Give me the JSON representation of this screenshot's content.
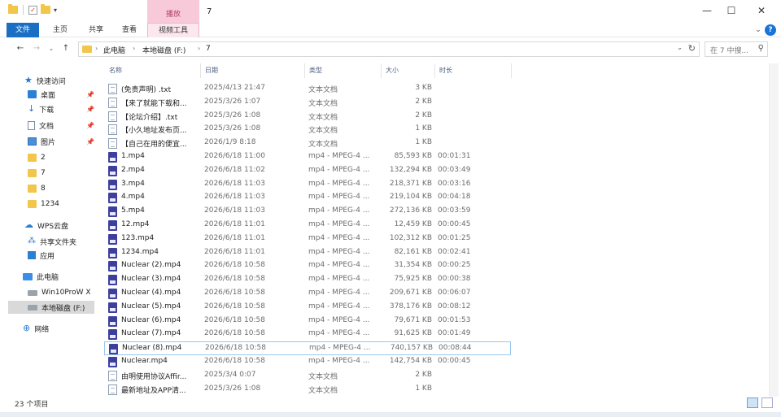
{
  "window": {
    "title": "7",
    "context_tab_top": "播放",
    "controls": {
      "minimize": "—",
      "maximize": "☐",
      "close": "✕"
    }
  },
  "ribbon": {
    "tabs": [
      "文件",
      "主页",
      "共享",
      "查看",
      "视频工具"
    ],
    "help": "?"
  },
  "address": {
    "crumbs": [
      "此电脑",
      "本地磁盘 (F:)",
      "7"
    ],
    "search_placeholder": "在 7 中搜..."
  },
  "sidebar": {
    "items": [
      {
        "label": "快速访问",
        "icon": "star-icon"
      },
      {
        "label": "桌面",
        "icon": "desktop-icon",
        "pinned": true
      },
      {
        "label": "下载",
        "icon": "download-icon",
        "pinned": true
      },
      {
        "label": "文档",
        "icon": "document-icon",
        "pinned": true
      },
      {
        "label": "图片",
        "icon": "pictures-icon",
        "pinned": true
      },
      {
        "label": "2",
        "icon": "folder-icon"
      },
      {
        "label": "7",
        "icon": "folder-icon"
      },
      {
        "label": "8",
        "icon": "folder-icon"
      },
      {
        "label": "1234",
        "icon": "folder-icon"
      },
      {
        "label": "WPS云盘",
        "icon": "cloud-icon"
      },
      {
        "label": "共享文件夹",
        "icon": "share-icon"
      },
      {
        "label": "应用",
        "icon": "apps-icon"
      },
      {
        "label": "此电脑",
        "icon": "pc-icon"
      },
      {
        "label": "Win10ProW X",
        "icon": "drive-icon"
      },
      {
        "label": "本地磁盘 (F:)",
        "icon": "drive-icon",
        "selected": true
      },
      {
        "label": "网络",
        "icon": "network-icon"
      }
    ]
  },
  "columns": {
    "name": "名称",
    "date": "日期",
    "type": "类型",
    "size": "大小",
    "duration": "时长"
  },
  "files": [
    {
      "name": "(免责声明) .txt",
      "date": "2025/4/13 21:47",
      "type": "文本文档",
      "size": "3 KB",
      "duration": "",
      "kind": "txt"
    },
    {
      "name": "【来了就能下载和...",
      "date": "2025/3/26 1:07",
      "type": "文本文档",
      "size": "2 KB",
      "duration": "",
      "kind": "txt"
    },
    {
      "name": "【论坛介绍】.txt",
      "date": "2025/3/26 1:08",
      "type": "文本文档",
      "size": "2 KB",
      "duration": "",
      "kind": "txt"
    },
    {
      "name": "【小久地址发布页...",
      "date": "2025/3/26 1:08",
      "type": "文本文档",
      "size": "1 KB",
      "duration": "",
      "kind": "txt"
    },
    {
      "name": "【自己在用的便宜...",
      "date": "2026/1/9 8:18",
      "type": "文本文档",
      "size": "1 KB",
      "duration": "",
      "kind": "txt"
    },
    {
      "name": "1.mp4",
      "date": "2026/6/18 11:00",
      "type": "mp4 - MPEG-4 ...",
      "size": "85,593 KB",
      "duration": "00:01:31",
      "kind": "mp4"
    },
    {
      "name": "2.mp4",
      "date": "2026/6/18 11:02",
      "type": "mp4 - MPEG-4 ...",
      "size": "132,294 KB",
      "duration": "00:03:49",
      "kind": "mp4"
    },
    {
      "name": "3.mp4",
      "date": "2026/6/18 11:03",
      "type": "mp4 - MPEG-4 ...",
      "size": "218,371 KB",
      "duration": "00:03:16",
      "kind": "mp4"
    },
    {
      "name": "4.mp4",
      "date": "2026/6/18 11:03",
      "type": "mp4 - MPEG-4 ...",
      "size": "219,104 KB",
      "duration": "00:04:18",
      "kind": "mp4"
    },
    {
      "name": "5.mp4",
      "date": "2026/6/18 11:03",
      "type": "mp4 - MPEG-4 ...",
      "size": "272,136 KB",
      "duration": "00:03:59",
      "kind": "mp4"
    },
    {
      "name": "12.mp4",
      "date": "2026/6/18 11:01",
      "type": "mp4 - MPEG-4 ...",
      "size": "12,459 KB",
      "duration": "00:00:45",
      "kind": "mp4"
    },
    {
      "name": "123.mp4",
      "date": "2026/6/18 11:01",
      "type": "mp4 - MPEG-4 ...",
      "size": "102,312 KB",
      "duration": "00:01:25",
      "kind": "mp4"
    },
    {
      "name": "1234.mp4",
      "date": "2026/6/18 11:01",
      "type": "mp4 - MPEG-4 ...",
      "size": "82,161 KB",
      "duration": "00:02:41",
      "kind": "mp4"
    },
    {
      "name": "Nuclear (2).mp4",
      "date": "2026/6/18 10:58",
      "type": "mp4 - MPEG-4 ...",
      "size": "31,354 KB",
      "duration": "00:00:25",
      "kind": "mp4"
    },
    {
      "name": "Nuclear (3).mp4",
      "date": "2026/6/18 10:58",
      "type": "mp4 - MPEG-4 ...",
      "size": "75,925 KB",
      "duration": "00:00:38",
      "kind": "mp4"
    },
    {
      "name": "Nuclear (4).mp4",
      "date": "2026/6/18 10:58",
      "type": "mp4 - MPEG-4 ...",
      "size": "209,671 KB",
      "duration": "00:06:07",
      "kind": "mp4"
    },
    {
      "name": "Nuclear (5).mp4",
      "date": "2026/6/18 10:58",
      "type": "mp4 - MPEG-4 ...",
      "size": "378,176 KB",
      "duration": "00:08:12",
      "kind": "mp4"
    },
    {
      "name": "Nuclear (6).mp4",
      "date": "2026/6/18 10:58",
      "type": "mp4 - MPEG-4 ...",
      "size": "79,671 KB",
      "duration": "00:01:53",
      "kind": "mp4"
    },
    {
      "name": "Nuclear (7).mp4",
      "date": "2026/6/18 10:58",
      "type": "mp4 - MPEG-4 ...",
      "size": "91,625 KB",
      "duration": "00:01:49",
      "kind": "mp4"
    },
    {
      "name": "Nuclear (8).mp4",
      "date": "2026/6/18 10:58",
      "type": "mp4 - MPEG-4 ...",
      "size": "740,157 KB",
      "duration": "00:08:44",
      "kind": "mp4",
      "focused": true
    },
    {
      "name": "Nuclear.mp4",
      "date": "2026/6/18 10:58",
      "type": "mp4 - MPEG-4 ...",
      "size": "142,754 KB",
      "duration": "00:00:45",
      "kind": "mp4"
    },
    {
      "name": "由明使用协议Affir...",
      "date": "2025/3/4 0:07",
      "type": "文本文档",
      "size": "2 KB",
      "duration": "",
      "kind": "txt"
    },
    {
      "name": "最新地址及APP清...",
      "date": "2025/3/26 1:08",
      "type": "文本文档",
      "size": "1 KB",
      "duration": "",
      "kind": "txt"
    }
  ],
  "status": {
    "count": "23 个项目"
  },
  "colors": {
    "file_tab": "#1a6fc4",
    "context_tab": "#f7c9d9",
    "selected_row_border": "#99c7ee"
  }
}
